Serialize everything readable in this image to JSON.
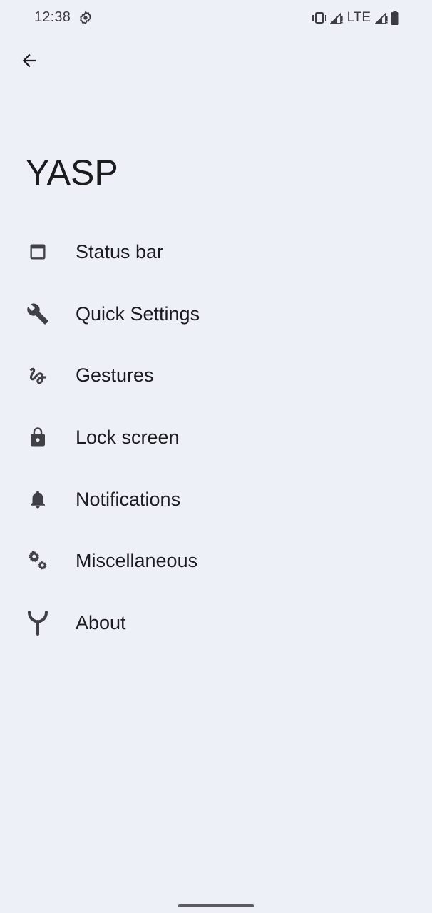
{
  "status_bar": {
    "time": "12:38",
    "network_label": "LTE",
    "icons": [
      "settings-gear-icon",
      "vibrate-icon",
      "signal-icon",
      "signal-icon",
      "battery-icon"
    ]
  },
  "toolbar": {
    "back_icon": "arrow-back-icon"
  },
  "page": {
    "title": "YASP"
  },
  "menu": {
    "items": [
      {
        "label": "Status bar",
        "icon": "window-icon"
      },
      {
        "label": "Quick Settings",
        "icon": "wrench-icon"
      },
      {
        "label": "Gestures",
        "icon": "gesture-icon"
      },
      {
        "label": "Lock screen",
        "icon": "lock-icon"
      },
      {
        "label": "Notifications",
        "icon": "bell-icon"
      },
      {
        "label": "Miscellaneous",
        "icon": "gears-icon"
      },
      {
        "label": "About",
        "icon": "y-logo-icon"
      }
    ]
  },
  "colors": {
    "background": "#eef0f8",
    "icon": "#3f4147",
    "text": "#1b1c20"
  }
}
